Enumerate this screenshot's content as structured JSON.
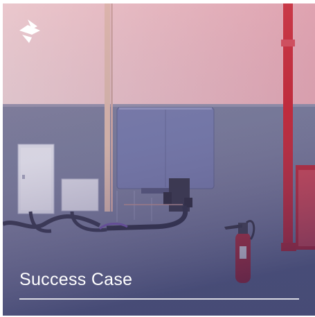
{
  "card": {
    "title": "Success Case",
    "logo_icon": "brand-logo-icon",
    "colors": {
      "wall_upper": "#e6c4c8",
      "wall_lower": "#6b7392",
      "tint_top": "#f2a8b6",
      "tint_bottom": "#2a2f63",
      "inverter": "#6d76a8",
      "pipe_red": "#c8202c",
      "text": "#ffffff"
    }
  }
}
